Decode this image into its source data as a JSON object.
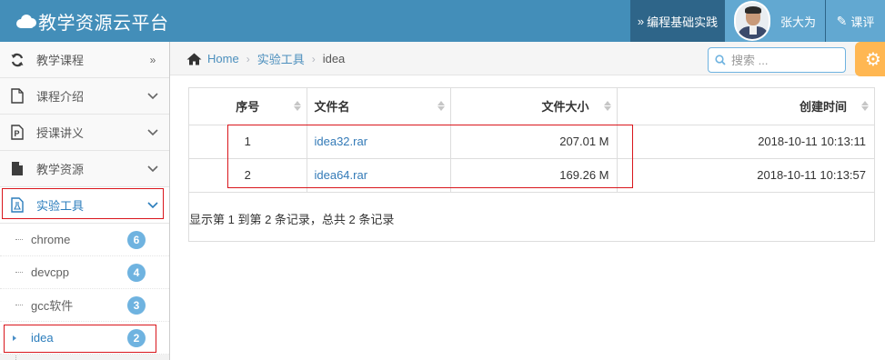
{
  "app": {
    "title": "教学资源云平台"
  },
  "header": {
    "program_link": "编程基础实践",
    "user_name": "张大为",
    "evaluate_label": "课评"
  },
  "sidebar": {
    "items": [
      {
        "label": "教学课程",
        "icon": "refresh-icon",
        "arrow": "double-chevron-right"
      },
      {
        "label": "课程介绍",
        "icon": "document-icon",
        "arrow": "chevron-down"
      },
      {
        "label": "授课讲义",
        "icon": "powerpoint-icon",
        "arrow": "chevron-down"
      },
      {
        "label": "教学资源",
        "icon": "file-icon",
        "arrow": "chevron-down"
      },
      {
        "label": "实验工具",
        "icon": "flask-icon",
        "arrow": "chevron-down",
        "active": true
      }
    ],
    "subitems": [
      {
        "label": "chrome",
        "badge": "6"
      },
      {
        "label": "devcpp",
        "badge": "4"
      },
      {
        "label": "gcc软件",
        "badge": "3"
      },
      {
        "label": "idea",
        "badge": "2",
        "active": true
      }
    ]
  },
  "breadcrumb": {
    "home": "Home",
    "parent": "实验工具",
    "current": "idea"
  },
  "search": {
    "placeholder": "搜索 ..."
  },
  "table": {
    "columns": [
      "序号",
      "文件名",
      "文件大小",
      "创建时间"
    ],
    "rows": [
      {
        "index": "1",
        "name": "idea32.rar",
        "size": "207.01 M",
        "created": "2018-10-11 10:13:11"
      },
      {
        "index": "2",
        "name": "idea64.rar",
        "size": "169.26 M",
        "created": "2018-10-11 10:13:57"
      }
    ],
    "summary": "显示第 1 到第 2 条记录，总共 2 条记录"
  },
  "colors": {
    "header_bg": "#438eb9",
    "accent": "#2b7dbc",
    "badge": "#6fb3e0",
    "highlight_box": "#d9161c",
    "settings": "#ffb752"
  }
}
